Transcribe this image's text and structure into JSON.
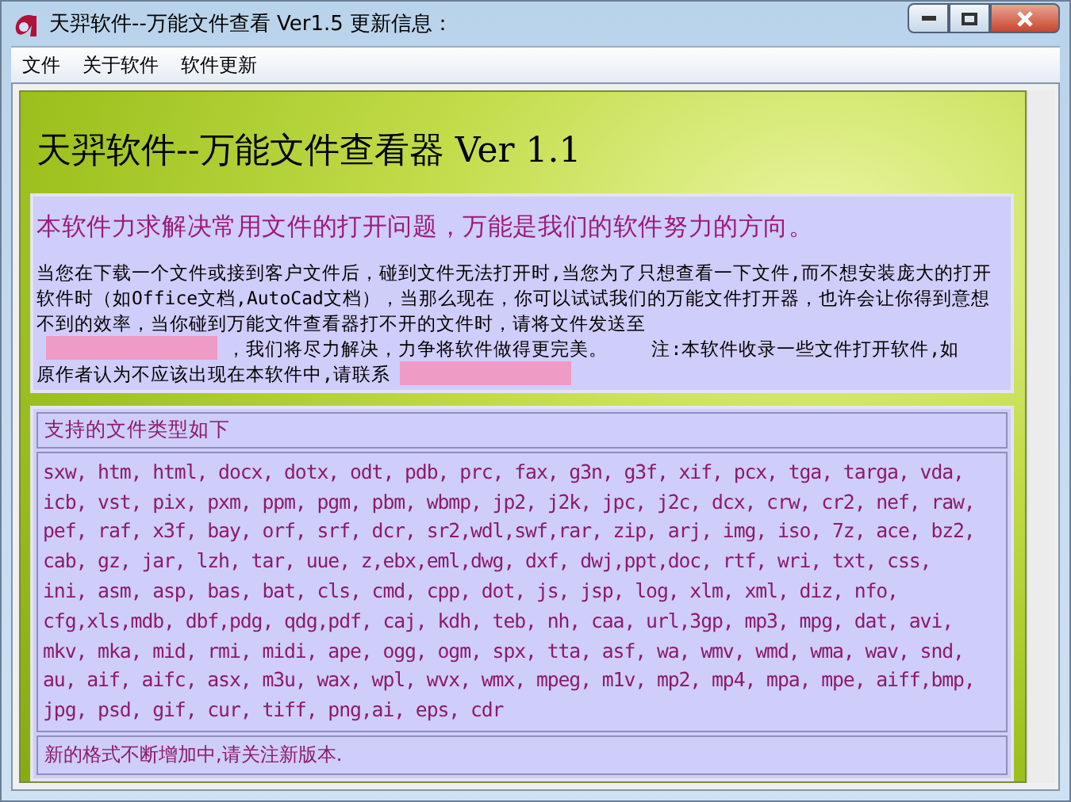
{
  "window": {
    "title": "天羿软件--万能文件查看 Ver1.5  更新信息："
  },
  "menu": [
    {
      "label": "文件"
    },
    {
      "label": "关于软件"
    },
    {
      "label": "软件更新"
    }
  ],
  "heading": "天羿软件--万能文件查看器  Ver 1.1",
  "intro": {
    "headline": "本软件力求解决常用文件的打开问题，万能是我们的软件努力的方向。",
    "parts": [
      {
        "kind": "text",
        "text": "当您在下载一个文件或接到客户文件后，碰到文件无法打开时,当您为了只想查看一下文件,而不想安装庞大的打开软件时（如Office文档,AutoCad文档），当那么现在，你可以试试我们的万能文件打开器，也许会让你得到意想不到的效率，当你碰到万能文件查看器打不开的文件时，请将文件发送至"
      },
      {
        "kind": "line",
        "items": [
          {
            "kind": "redacted"
          },
          {
            "kind": "text",
            "text": "，我们将尽力解决，力争将软件做得更完美。    注:本软件收录一些文件打开软件,如"
          }
        ]
      },
      {
        "kind": "line",
        "items": [
          {
            "kind": "text",
            "text": "原作者认为不应该出现在本软件中,请联系"
          },
          {
            "kind": "redacted"
          }
        ]
      }
    ]
  },
  "formats": {
    "header": "支持的文件类型如下",
    "lines": [
      "sxw, htm, html, docx, dotx, odt, pdb, prc, fax, g3n, g3f, xif, pcx, tga, targa, vda,",
      "icb, vst, pix, pxm, ppm, pgm, pbm, wbmp, jp2, j2k, jpc, j2c, dcx, crw, cr2, nef, raw,",
      "pef, raf, x3f, bay, orf, srf, dcr, sr2,wdl,swf,rar, zip, arj, img, iso, 7z, ace, bz2,",
      "cab, gz, jar, lzh, tar, uue, z,ebx,eml,dwg, dxf, dwj,ppt,doc, rtf, wri, txt, css,",
      "ini, asm, asp, bas, bat, cls, cmd, cpp, dot, js, jsp, log, xlm, xml, diz, nfo,",
      "cfg,xls,mdb, dbf,pdg, qdg,pdf, caj, kdh, teb, nh, caa, url,3gp, mp3, mpg, dat, avi,",
      "mkv, mka, mid, rmi, midi, ape, ogg, ogm, spx, tta, asf, wa, wmv, wmd, wma, wav, snd,",
      "au, aif, aifc, asx, m3u, wax, wpl, wvx, wmx, mpeg, m1v, mp2, mp4, mpa, mpe, aiff,bmp,",
      "jpg, psd, gif, cur, tiff, png,ai, eps, cdr"
    ],
    "footer": "新的格式不断增加中,请关注新版本."
  }
}
